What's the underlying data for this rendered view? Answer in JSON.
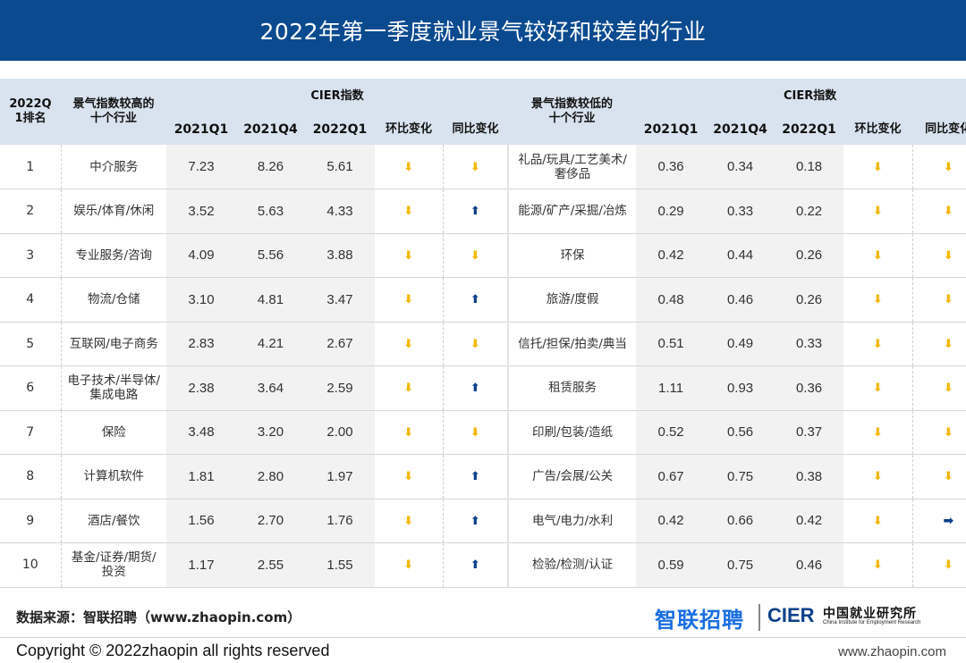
{
  "title": "2022年第一季度就业景气较好和较差的行业",
  "headers": {
    "rank": "2022Q 1排名",
    "high_industry": "景气指数较高的 十个行业",
    "low_industry": "景气指数较低的 十个行业",
    "cier_group_left": "CIER指数",
    "cier_group_right": "CIER指数",
    "q2021q1": "2021Q1",
    "q2021q4": "2021Q4",
    "q2022q1": "2022Q1",
    "qoq": "环比变化",
    "yoy": "同比变化"
  },
  "rows": [
    {
      "rank": "1",
      "high": {
        "name": "中介服务",
        "v2021q1": "7.23",
        "v2021q4": "8.26",
        "v2022q1": "5.61",
        "qoq": "down",
        "yoy": "down"
      },
      "low": {
        "name": "礼品/玩具/工艺美术/奢侈品",
        "v2021q1": "0.36",
        "v2021q4": "0.34",
        "v2022q1": "0.18",
        "qoq": "down",
        "yoy": "down"
      }
    },
    {
      "rank": "2",
      "high": {
        "name": "娱乐/体育/休闲",
        "v2021q1": "3.52",
        "v2021q4": "5.63",
        "v2022q1": "4.33",
        "qoq": "down",
        "yoy": "up"
      },
      "low": {
        "name": "能源/矿产/采掘/冶炼",
        "v2021q1": "0.29",
        "v2021q4": "0.33",
        "v2022q1": "0.22",
        "qoq": "down",
        "yoy": "down"
      }
    },
    {
      "rank": "3",
      "high": {
        "name": "专业服务/咨询",
        "v2021q1": "4.09",
        "v2021q4": "5.56",
        "v2022q1": "3.88",
        "qoq": "down",
        "yoy": "down"
      },
      "low": {
        "name": "环保",
        "v2021q1": "0.42",
        "v2021q4": "0.44",
        "v2022q1": "0.26",
        "qoq": "down",
        "yoy": "down"
      }
    },
    {
      "rank": "4",
      "high": {
        "name": "物流/仓储",
        "v2021q1": "3.10",
        "v2021q4": "4.81",
        "v2022q1": "3.47",
        "qoq": "down",
        "yoy": "up"
      },
      "low": {
        "name": "旅游/度假",
        "v2021q1": "0.48",
        "v2021q4": "0.46",
        "v2022q1": "0.26",
        "qoq": "down",
        "yoy": "down"
      }
    },
    {
      "rank": "5",
      "high": {
        "name": "互联网/电子商务",
        "v2021q1": "2.83",
        "v2021q4": "4.21",
        "v2022q1": "2.67",
        "qoq": "down",
        "yoy": "down"
      },
      "low": {
        "name": "信托/担保/拍卖/典当",
        "v2021q1": "0.51",
        "v2021q4": "0.49",
        "v2022q1": "0.33",
        "qoq": "down",
        "yoy": "down"
      }
    },
    {
      "rank": "6",
      "high": {
        "name": "电子技术/半导体/集成电路",
        "v2021q1": "2.38",
        "v2021q4": "3.64",
        "v2022q1": "2.59",
        "qoq": "down",
        "yoy": "up"
      },
      "low": {
        "name": "租赁服务",
        "v2021q1": "1.11",
        "v2021q4": "0.93",
        "v2022q1": "0.36",
        "qoq": "down",
        "yoy": "down"
      }
    },
    {
      "rank": "7",
      "high": {
        "name": "保险",
        "v2021q1": "3.48",
        "v2021q4": "3.20",
        "v2022q1": "2.00",
        "qoq": "down",
        "yoy": "down"
      },
      "low": {
        "name": "印刷/包装/造纸",
        "v2021q1": "0.52",
        "v2021q4": "0.56",
        "v2022q1": "0.37",
        "qoq": "down",
        "yoy": "down"
      }
    },
    {
      "rank": "8",
      "high": {
        "name": "计算机软件",
        "v2021q1": "1.81",
        "v2021q4": "2.80",
        "v2022q1": "1.97",
        "qoq": "down",
        "yoy": "up"
      },
      "low": {
        "name": "广告/会展/公关",
        "v2021q1": "0.67",
        "v2021q4": "0.75",
        "v2022q1": "0.38",
        "qoq": "down",
        "yoy": "down"
      }
    },
    {
      "rank": "9",
      "high": {
        "name": "酒店/餐饮",
        "v2021q1": "1.56",
        "v2021q4": "2.70",
        "v2022q1": "1.76",
        "qoq": "down",
        "yoy": "up"
      },
      "low": {
        "name": "电气/电力/水利",
        "v2021q1": "0.42",
        "v2021q4": "0.66",
        "v2022q1": "0.42",
        "qoq": "down",
        "yoy": "flat"
      }
    },
    {
      "rank": "10",
      "high": {
        "name": "基金/证券/期货/投资",
        "v2021q1": "1.17",
        "v2021q4": "2.55",
        "v2022q1": "1.55",
        "qoq": "down",
        "yoy": "up"
      },
      "low": {
        "name": "检验/检测/认证",
        "v2021q1": "0.59",
        "v2021q4": "0.75",
        "v2022q1": "0.46",
        "qoq": "down",
        "yoy": "down"
      }
    }
  ],
  "source_text": "数据来源：智联招聘（www.zhaopin.com）",
  "logo": {
    "zhaopin": "智联招聘",
    "cier": "CIER",
    "cier_cn": "中国就业研究所",
    "cier_en": "China Institute for Employment Research"
  },
  "copyright": "Copyright ©  2022zhaopin all rights reserved",
  "website": "www.zhaopin.com",
  "colors": {
    "header_bg": "#0b4a8f",
    "table_header_bg": "#d9e3ef",
    "arrow_down": "#f2b800",
    "arrow_up": "#0b3f8a"
  }
}
